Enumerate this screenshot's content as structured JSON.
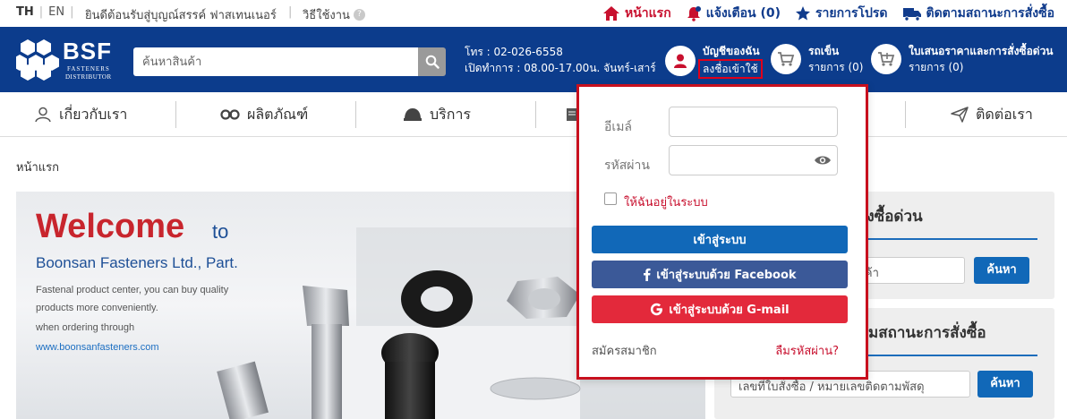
{
  "topbar": {
    "lang_th": "TH",
    "lang_en": "EN",
    "welcome": "ยินดีต้อนรับสู่บุญณ์สรรค์ ฟาสเทนเนอร์",
    "howto": "วิธีใช้งาน",
    "help_mark": "?",
    "links": [
      {
        "label": "หน้าแรก",
        "icon": "home-icon"
      },
      {
        "label": "แจ้งเตือน (0)",
        "icon": "bell-icon"
      },
      {
        "label": "รายการโปรด",
        "icon": "star-icon"
      },
      {
        "label": "ติดตามสถานะการสั่งซื้อ",
        "icon": "truck-icon"
      }
    ]
  },
  "header": {
    "logo_text": "BSF",
    "logo_sub1": "FASTENERS",
    "logo_sub2": "DISTRIBUTOR",
    "search_placeholder": "ค้นหาสินค้า",
    "phone": "โทร : 02-026-6558",
    "hours": "เปิดทำการ : 08.00-17.00น. จันทร์-เสาร์",
    "account_title": "บัญชีของฉัน",
    "account_login": "ลงชื่อเข้าใช้",
    "cart_title": "รถเข็น",
    "cart_count": "รายการ (0)",
    "quote_title": "ใบเสนอราคาและการสั่งซื้อด่วน",
    "quote_count": "รายการ (0)"
  },
  "nav": {
    "items": [
      {
        "label": "เกี่ยวกับเรา",
        "icon": "user-icon"
      },
      {
        "label": "ผลิตภัณฑ์",
        "icon": "wrench-icon"
      },
      {
        "label": "บริการ",
        "icon": "helmet-icon"
      },
      {
        "label": "ติดต่อเรา",
        "icon": "send-icon"
      }
    ]
  },
  "breadcrumb": "หน้าแรก",
  "banner": {
    "welcome": "Welcome",
    "to": "to",
    "company": "Boonsan Fasteners Ltd., Part.",
    "line1": "Fastenal product center, you can buy quality",
    "line2": "products more conveniently.",
    "line3": "when ordering through",
    "url": "www.boonsanfasteners.com"
  },
  "quick_order": {
    "title": "สั่งซื้อด่วน",
    "input_value": "นค้า",
    "button": "ค้นหา"
  },
  "track_order": {
    "title": "มสถานะการสั่งซื้อ",
    "input_value": "เลขที่ใบสั่งซื้อ / หมายเลขติดตามพัสดุ",
    "button": "ค้นหา"
  },
  "login": {
    "email_label": "อีเมล์",
    "password_label": "รหัสผ่าน",
    "remember": "ให้ฉันอยู่ในระบบ",
    "login_btn": "เข้าสู่ระบบ",
    "fb_btn": "เข้าสู่ระบบด้วย Facebook",
    "gmail_btn": "เข้าสู่ระบบด้วย G-mail",
    "register": "สมัครสมาชิก",
    "forgot": "ลืมรหัสผ่าน?"
  },
  "colors": {
    "brand_blue": "#0c3c8c",
    "accent_red": "#c8102e",
    "button_blue": "#1168b8",
    "facebook": "#3b5998",
    "gmail": "#e3293b"
  }
}
